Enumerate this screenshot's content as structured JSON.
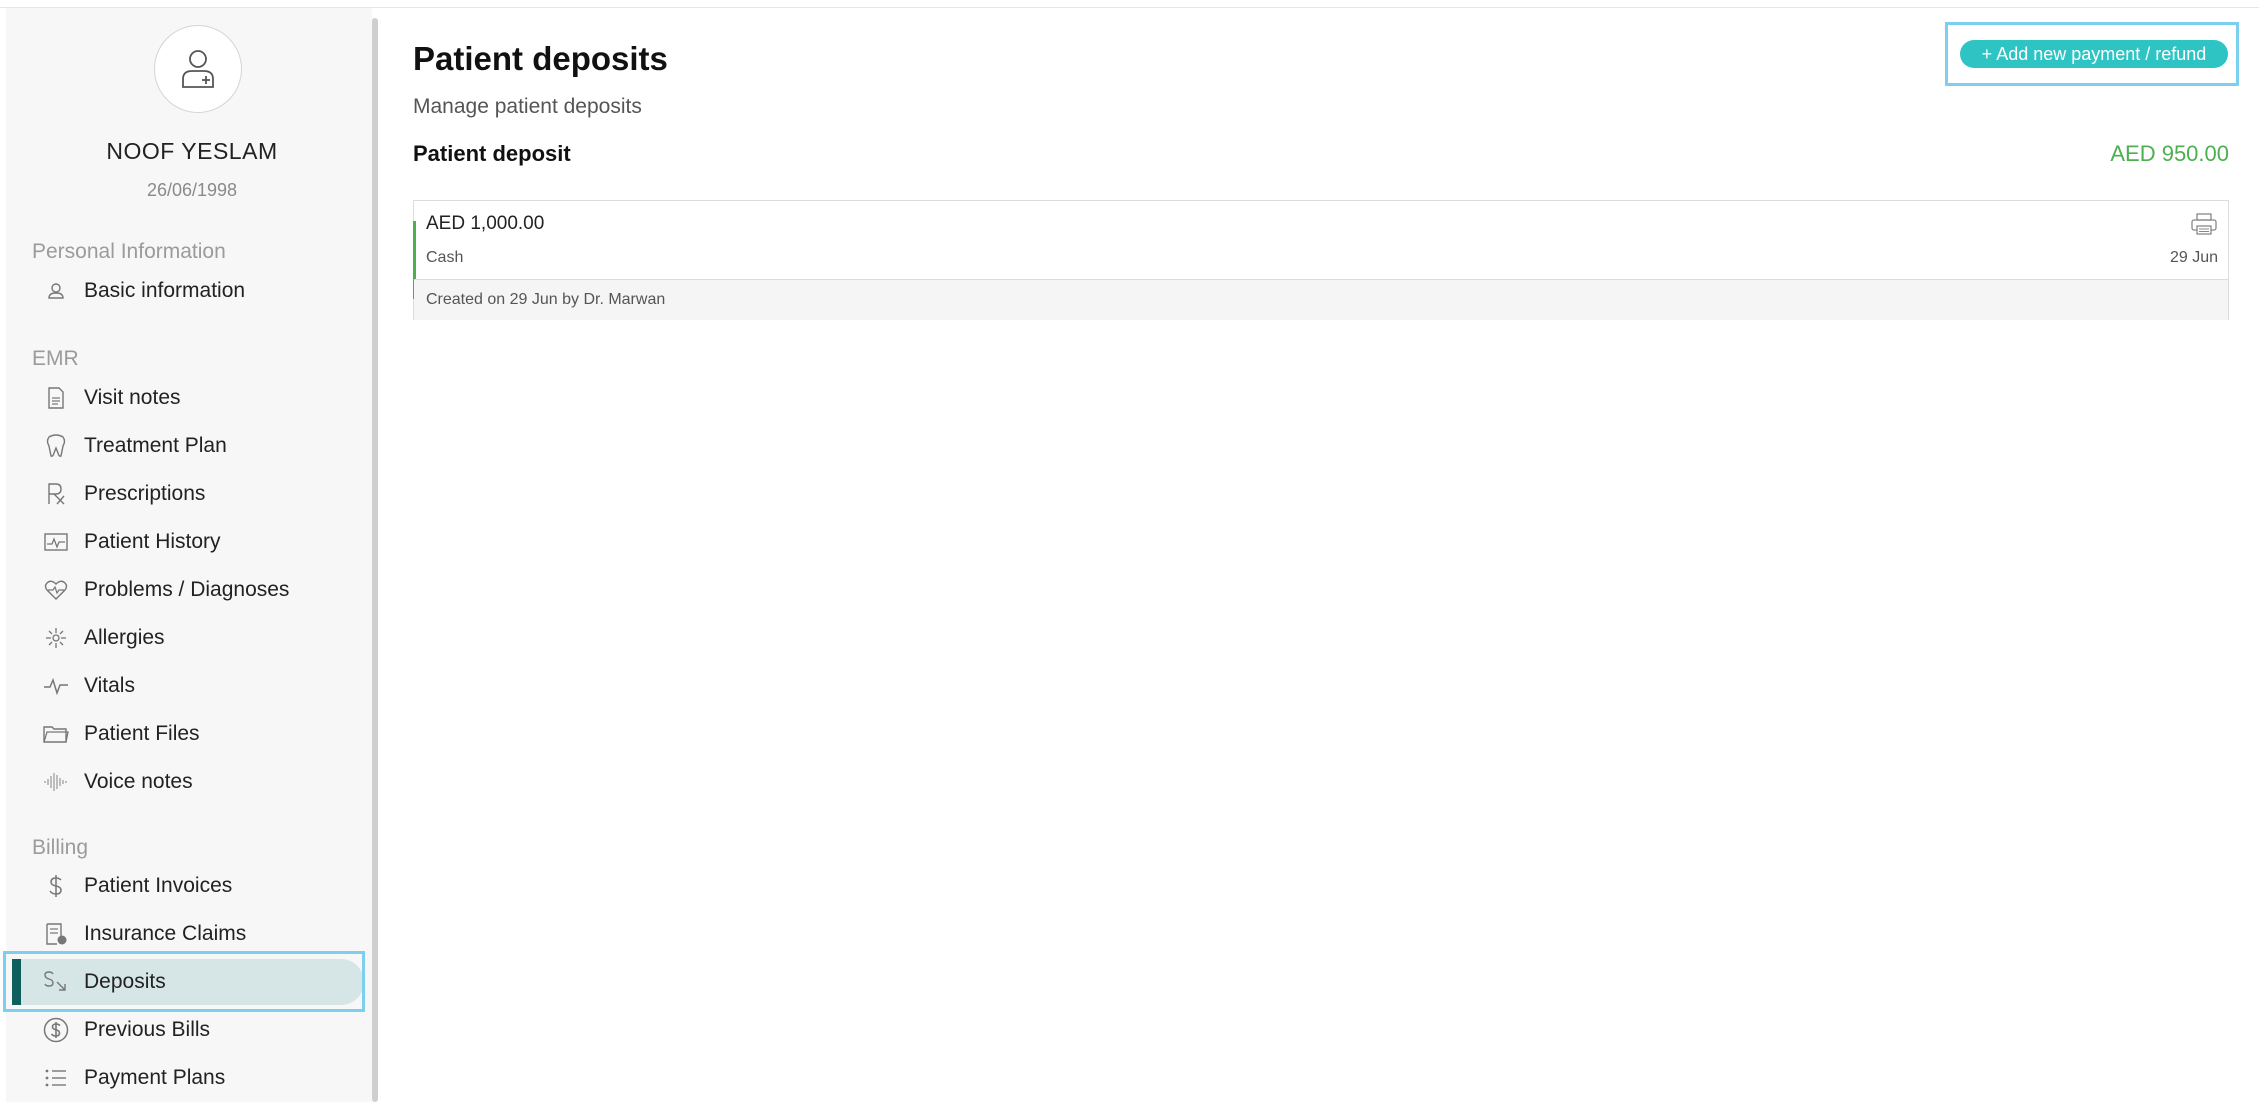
{
  "patient": {
    "name": "NOOF YESLAM",
    "dob": "26/06/1998"
  },
  "sidebar": {
    "sections": [
      {
        "label": "Personal Information"
      },
      {
        "label": "EMR"
      },
      {
        "label": "Billing"
      }
    ],
    "items": [
      {
        "label": "Basic information",
        "icon": "person-icon"
      },
      {
        "label": "Visit notes",
        "icon": "document-icon"
      },
      {
        "label": "Treatment Plan",
        "icon": "tooth-icon"
      },
      {
        "label": "Prescriptions",
        "icon": "prescription-icon"
      },
      {
        "label": "Patient History",
        "icon": "history-chart-icon"
      },
      {
        "label": "Problems / Diagnoses",
        "icon": "heart-pulse-icon"
      },
      {
        "label": "Allergies",
        "icon": "allergy-icon"
      },
      {
        "label": "Vitals",
        "icon": "pulse-icon"
      },
      {
        "label": "Patient Files",
        "icon": "folder-icon"
      },
      {
        "label": "Voice notes",
        "icon": "waveform-icon"
      },
      {
        "label": "Patient Invoices",
        "icon": "dollar-icon"
      },
      {
        "label": "Insurance Claims",
        "icon": "claim-document-icon"
      },
      {
        "label": "Deposits",
        "icon": "deposit-icon"
      },
      {
        "label": "Previous Bills",
        "icon": "dollar-circle-icon"
      },
      {
        "label": "Payment Plans",
        "icon": "list-icon"
      }
    ],
    "active_item": "Deposits"
  },
  "main": {
    "title": "Patient deposits",
    "subtitle": "Manage patient deposits",
    "add_button_label": "+ Add new payment / refund",
    "deposit_label": "Patient deposit",
    "deposit_total": "AED 950.00",
    "deposits": [
      {
        "amount": "AED 1,000.00",
        "method": "Cash",
        "date": "29 Jun",
        "footer": "Created on 29 Jun by Dr. Marwan"
      }
    ]
  },
  "colors": {
    "accent": "#2ec4c4",
    "active_bar": "#0f5e5e",
    "active_bg": "#d6e6e6",
    "positive": "#4caf50",
    "focus_outline": "#7cd0ef"
  }
}
